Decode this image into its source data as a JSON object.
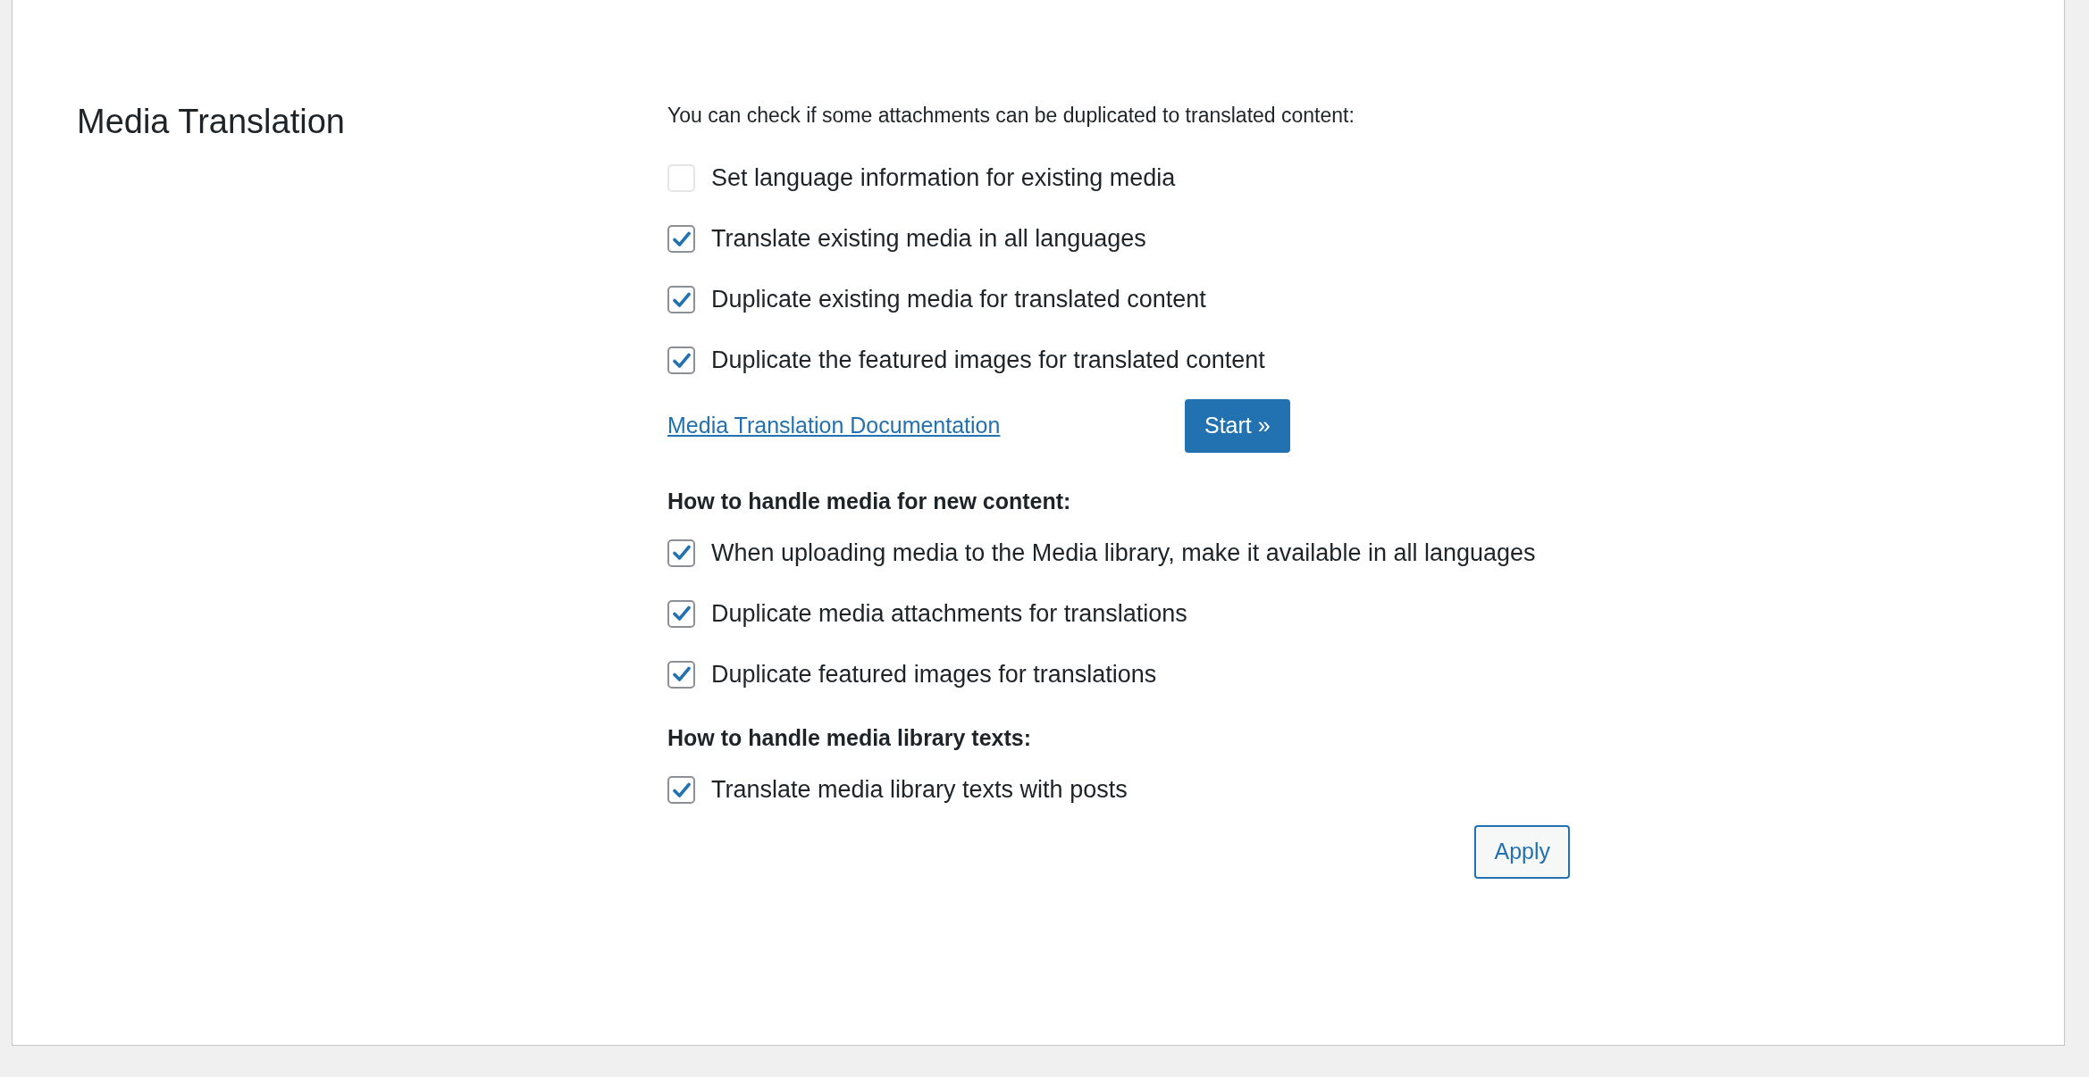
{
  "title": "Media Translation",
  "intro": "You can check if some attachments can be duplicated to translated content:",
  "existing_options": [
    {
      "label": "Set language information for existing media",
      "checked": false
    },
    {
      "label": "Translate existing media in all languages",
      "checked": true
    },
    {
      "label": "Duplicate existing media for translated content",
      "checked": true
    },
    {
      "label": "Duplicate the featured images for translated content",
      "checked": true
    }
  ],
  "documentation_link": "Media Translation Documentation",
  "start_button": "Start »",
  "sections": [
    {
      "heading": "How to handle media for new content:",
      "options": [
        {
          "label": "When uploading media to the Media library, make it available in all languages",
          "checked": true
        },
        {
          "label": "Duplicate media attachments for translations",
          "checked": true
        },
        {
          "label": "Duplicate featured images for translations",
          "checked": true
        }
      ]
    },
    {
      "heading": "How to handle media library texts:",
      "options": [
        {
          "label": "Translate media library texts with posts",
          "checked": true
        }
      ]
    }
  ],
  "apply_button": "Apply"
}
